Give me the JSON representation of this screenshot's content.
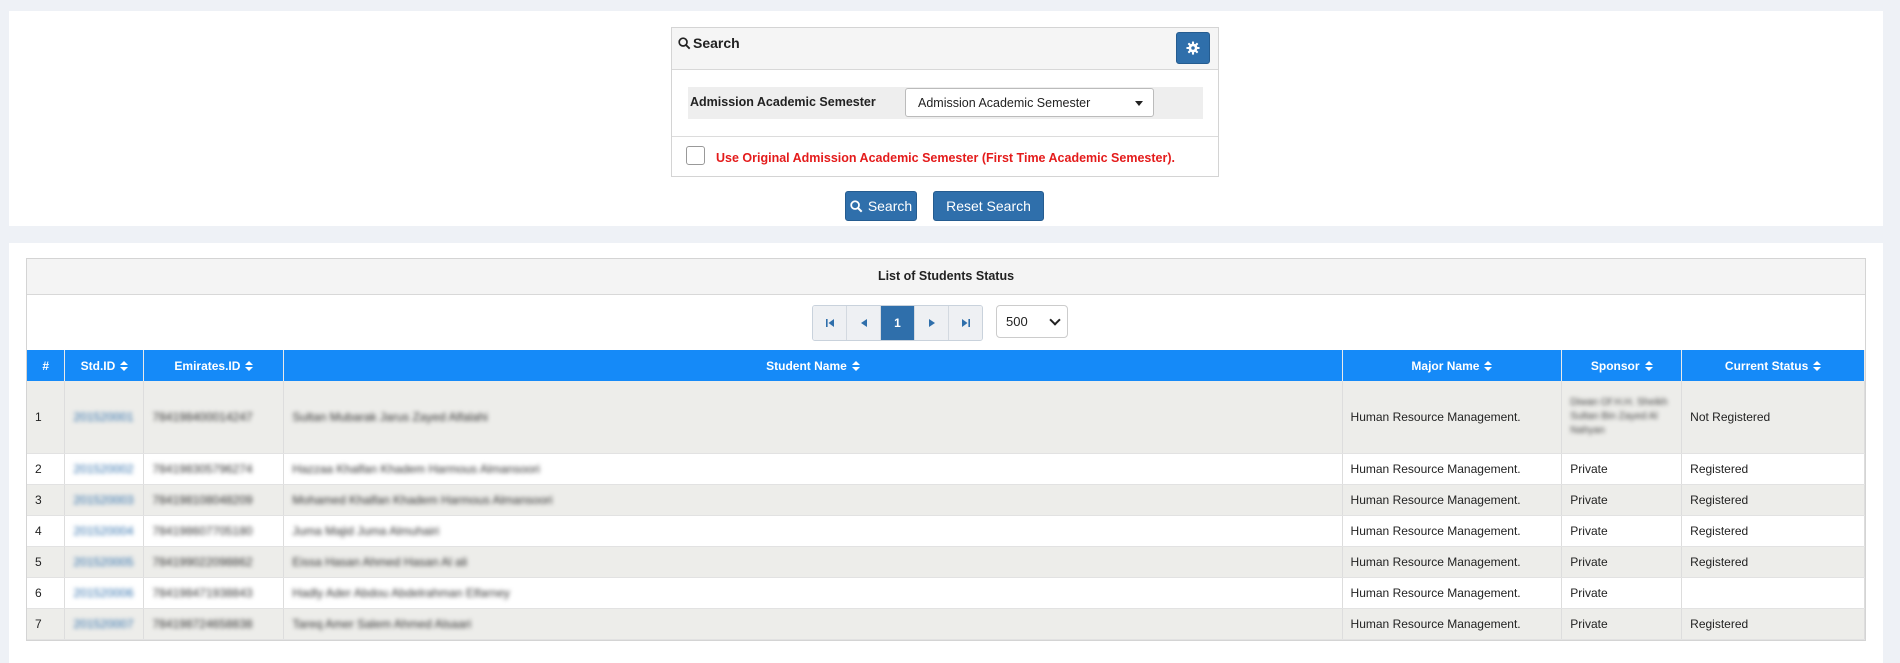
{
  "search": {
    "title": "Search",
    "semester_label": "Admission Academic Semester",
    "semester_value": "Admission Academic Semester",
    "checkbox_label": "Use Original Admission Academic Semester (First Time Academic Semester).",
    "search_button": "Search",
    "reset_button": "Reset Search"
  },
  "table": {
    "caption": "List of Students Status",
    "current_page": "1",
    "page_size": "500",
    "columns": [
      "#",
      "Std.ID",
      "Emirates.ID",
      "Student Name",
      "Major Name",
      "Sponsor",
      "Current Status"
    ],
    "rows": [
      {
        "n": "1",
        "std": "201520001",
        "eid": "784198400014247",
        "name": "Sultan Mubarak Jarus Zayed Alfalahi",
        "major": "Human Resource Management.",
        "sponsor": "Diwan Of H.H. Sheikh Sultan Bin Zayed Al Nahyan",
        "status": "Not Registered"
      },
      {
        "n": "2",
        "std": "201520002",
        "eid": "784198305796274",
        "name": "Hazzaa Khalfan Khadem Harmous Almansoori",
        "major": "Human Resource Management.",
        "sponsor": "Private",
        "status": "Registered"
      },
      {
        "n": "3",
        "std": "201520003",
        "eid": "784198108048209",
        "name": "Mohamed Khalfan Khadem Harmous Almansoori",
        "major": "Human Resource Management.",
        "sponsor": "Private",
        "status": "Registered"
      },
      {
        "n": "4",
        "std": "201520004",
        "eid": "784198607705180",
        "name": "Juma Majid Juma Almuhairi",
        "major": "Human Resource Management.",
        "sponsor": "Private",
        "status": "Registered"
      },
      {
        "n": "5",
        "std": "201520005",
        "eid": "784199022098862",
        "name": "Eissa Hasan Ahmed Hasan Al ali",
        "major": "Human Resource Management.",
        "sponsor": "Private",
        "status": "Registered"
      },
      {
        "n": "6",
        "std": "201520006",
        "eid": "784198471938843",
        "name": "Hadly Ader Abdou Abdelrahman Elfarney",
        "major": "Human Resource Management.",
        "sponsor": "Private",
        "status": ""
      },
      {
        "n": "7",
        "std": "201520007",
        "eid": "784198724658838",
        "name": "Tareq Amer Salem Ahmed Alsaari",
        "major": "Human Resource Management.",
        "sponsor": "Private",
        "status": "Registered"
      }
    ]
  }
}
